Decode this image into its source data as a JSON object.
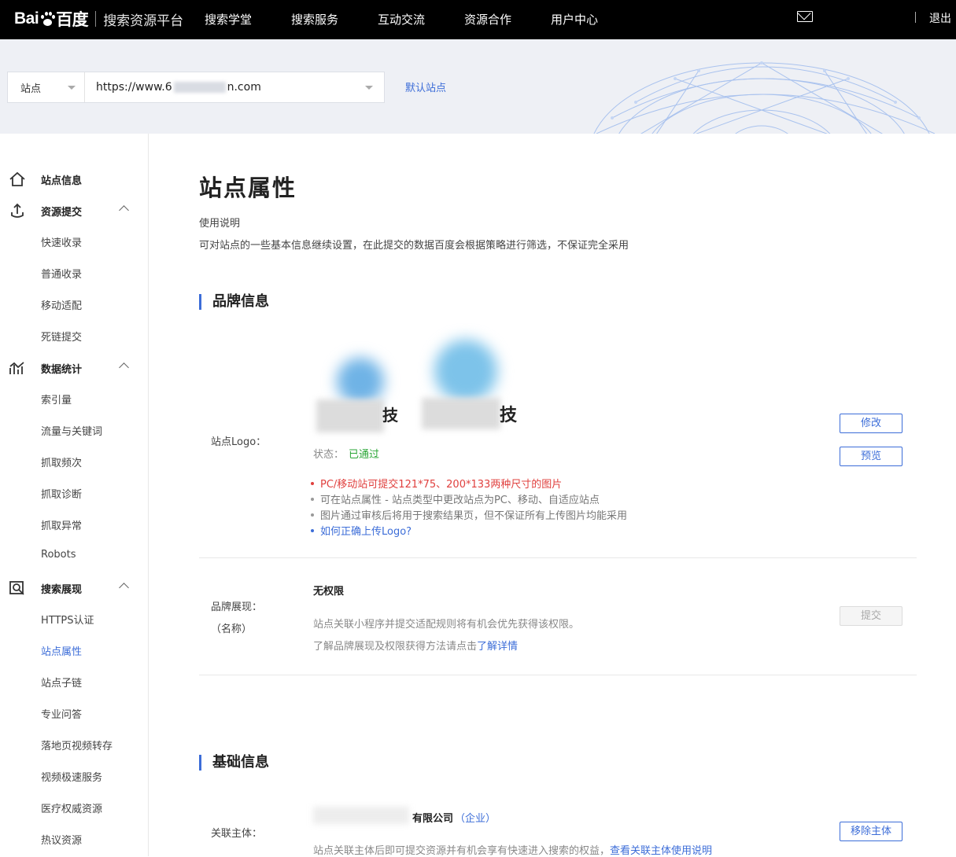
{
  "topbar": {
    "logo_text_left": "Bai",
    "logo_text_right": "百度",
    "platform": "搜索资源平台",
    "nav": [
      "搜索学堂",
      "搜索服务",
      "互动交流",
      "资源合作",
      "用户中心"
    ],
    "logout": "退出",
    "icons": {
      "mail": "mail-icon"
    }
  },
  "banner": {
    "site_type": "站点",
    "site_url_prefix": "https://www.6",
    "site_url_suffix": "n.com",
    "default_site": "默认站点"
  },
  "sidebar": {
    "groups": [
      {
        "label": "站点信息",
        "icon": "home-icon"
      },
      {
        "label": "资源提交",
        "icon": "submit-icon",
        "items": [
          "快速收录",
          "普通收录",
          "移动适配",
          "死链提交"
        ]
      },
      {
        "label": "数据统计",
        "icon": "chart-icon",
        "items": [
          "索引量",
          "流量与关键词",
          "抓取频次",
          "抓取诊断",
          "抓取异常",
          "Robots"
        ]
      },
      {
        "label": "搜索展现",
        "icon": "search-display-icon",
        "items": [
          "HTTPS认证",
          "站点属性",
          "站点子链",
          "专业问答",
          "落地页视频转存",
          "视频极速服务",
          "医疗权威资源",
          "热议资源"
        ]
      }
    ],
    "active_item": "站点属性"
  },
  "main": {
    "title": "站点属性",
    "usage_title": "使用说明",
    "usage_desc": "可对站点的一些基本信息继续设置，在此提交的数据百度会根据策略进行筛选，不保证完全采用",
    "brand_section": "品牌信息",
    "logo_row": {
      "label": "站点Logo：",
      "logo_char": "技",
      "status_label": "状态：",
      "status_value": "已通过",
      "tips": [
        "PC/移动站可提交121*75、200*133两种尺寸的图片",
        "可在站点属性 - 站点类型中更改站点为PC、移动、自适应站点",
        "图片通过审核后将用于搜索结果页，但不保证所有上传图片均能采用",
        "如何正确上传Logo?"
      ],
      "edit_btn": "修改",
      "preview_btn": "预览"
    },
    "brand_row": {
      "label_line1": "品牌展现：",
      "label_line2": "（名称）",
      "title": "无权限",
      "desc1": "站点关联小程序并提交适配规则将有机会优先获得该权限。",
      "desc2_prefix": "了解品牌展现及权限获得方法请点击",
      "desc2_link": "了解详情",
      "submit_btn": "提交"
    },
    "basic_section": "基础信息",
    "entity_row": {
      "label": "关联主体：",
      "company": "有限公司",
      "company_type": "（企业）",
      "desc_prefix": "站点关联主体后即可提交资源并有机会享有快速进入搜索的权益，",
      "desc_link": "查看关联主体使用说明",
      "remove_btn": "移除主体"
    }
  }
}
